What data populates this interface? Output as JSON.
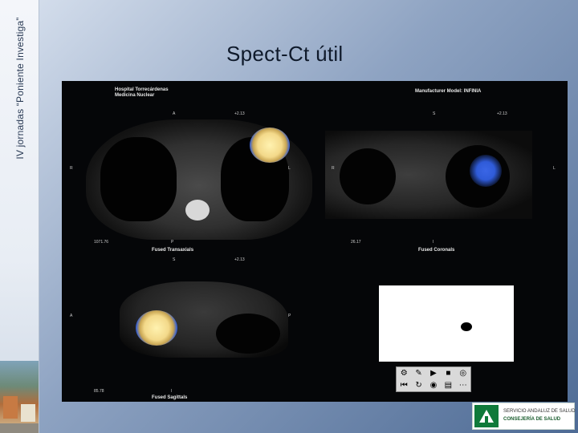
{
  "sidebar": {
    "vertical_title": "IV jornadas “Poniente Investiga”"
  },
  "slide": {
    "title": "Spect-Ct útil"
  },
  "viewer": {
    "hospital_line1": "Hospital Torrecárdenas",
    "hospital_line2": "Medicina Nuclear",
    "manufacturer": "Manufacturer Model: INFINIA",
    "top_left_orient": "A",
    "top_left_scale": "+2.13",
    "top_right_orient": "S",
    "top_right_scale": "+2.13",
    "mid_left_orient": "S",
    "mid_left_scale": "+2.13",
    "axial_left": "R",
    "axial_right": "L",
    "axial_value": "1071.76",
    "axial_bottom": "P",
    "axial_caption": "Fused Transaxials",
    "coronal_left": "R",
    "coronal_right": "L",
    "coronal_value": "26.17",
    "coronal_bottom": "I",
    "coronal_caption": "Fused Coronals",
    "sag_left": "A",
    "sag_right": "P",
    "sag_value": "85.78",
    "sag_bottom": "I",
    "sag_caption": "Fused Sagittals",
    "accent_blue": "#2f5bd8",
    "accent_yellow": "#f3d98a"
  },
  "toolbar": {
    "icons": [
      "tools-icon",
      "pen-icon",
      "play-icon",
      "stop-icon",
      "target-icon",
      "first-frame-icon",
      "loop-icon",
      "eye-icon",
      "stack-icon",
      "more-icon"
    ]
  },
  "logo": {
    "line1": "SERVICIO ANDALUZ DE SALUD",
    "line2": "CONSEJERÍA DE SALUD"
  }
}
